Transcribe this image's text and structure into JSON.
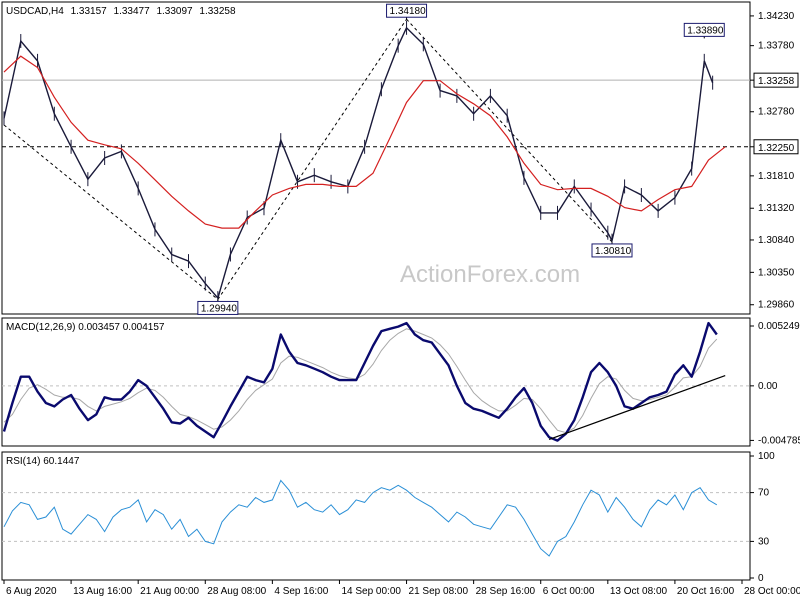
{
  "header": {
    "symbol": "USDCAD,H4",
    "open": "1.33157",
    "high": "1.33477",
    "low": "1.33097",
    "close": "1.33258"
  },
  "watermark": "ActionForex.com",
  "colors": {
    "bars": "#1a1a3a",
    "sma": "#d42020",
    "macd": "#0a0a6e",
    "signal": "#a8a8a8",
    "rsi": "#2a8fd6",
    "trend": "#000000",
    "price_tag_bg": "#ffffff"
  },
  "chart_data": [
    {
      "type": "line",
      "panel": "price",
      "ylim": [
        1.2975,
        1.3438
      ],
      "y_ticks": [
        "1.34230",
        "1.33780",
        "1.33258",
        "1.32780",
        "1.32250",
        "1.31810",
        "1.31320",
        "1.30840",
        "1.30350",
        "1.29860"
      ],
      "y_tick_values": [
        1.3423,
        1.3378,
        1.33258,
        1.3278,
        1.3225,
        1.3181,
        1.3132,
        1.3084,
        1.3035,
        1.2986
      ],
      "current_price": "1.33258",
      "current_price_value": 1.33258,
      "level_line": "1.32250",
      "level_line_value": 1.3225,
      "annotations": [
        {
          "label": "1.29940",
          "x": 25.5,
          "y": 1.2994
        },
        {
          "label": "1.34180",
          "x": 48.0,
          "y": 1.3418
        },
        {
          "label": "1.30810",
          "x": 72.5,
          "y": 1.3081
        },
        {
          "label": "1.33890",
          "x": 83.5,
          "y": 1.3389
        }
      ],
      "trendlines": [
        {
          "x": [
            0.0,
            25.5
          ],
          "y": [
            1.3258,
            1.2994
          ]
        },
        {
          "x": [
            25.5,
            48.0
          ],
          "y": [
            1.2994,
            1.3418
          ]
        },
        {
          "x": [
            48.0,
            72.5
          ],
          "y": [
            1.3418,
            1.3081
          ]
        }
      ],
      "series": [
        {
          "kind": "bars",
          "x": [
            0.0,
            2.0,
            4.0,
            6.0,
            8.0,
            10.0,
            12.0,
            14.0,
            16.0,
            18.0,
            20.0,
            22.0,
            24.0,
            25.5,
            27.0,
            29.0,
            31.0,
            33.0,
            35.0,
            37.0,
            39.0,
            41.0,
            43.0,
            45.0,
            47.0,
            48.0,
            50.0,
            52.0,
            54.0,
            56.0,
            58.0,
            60.0,
            62.0,
            64.0,
            66.0,
            68.0,
            70.0,
            72.0,
            72.5,
            74.0,
            76.0,
            78.0,
            80.0,
            82.0,
            83.5,
            84.5
          ],
          "y": [
            1.3268,
            1.3385,
            1.3355,
            1.3275,
            1.3225,
            1.3176,
            1.3208,
            1.3218,
            1.3162,
            1.31,
            1.3062,
            1.3052,
            1.3018,
            1.2996,
            1.3062,
            1.3118,
            1.3132,
            1.3235,
            1.3172,
            1.3182,
            1.3172,
            1.3165,
            1.3225,
            1.3312,
            1.3378,
            1.3405,
            1.338,
            1.331,
            1.3302,
            1.3275,
            1.3302,
            1.3272,
            1.3178,
            1.3125,
            1.3125,
            1.3165,
            1.313,
            1.3095,
            1.3083,
            1.3165,
            1.3152,
            1.3128,
            1.3148,
            1.3192,
            1.3355,
            1.3322
          ]
        },
        {
          "name": "SMA",
          "x": [
            0.0,
            2.0,
            4.0,
            6.0,
            8.0,
            10.0,
            12.0,
            14.0,
            16.0,
            18.0,
            20.0,
            22.0,
            24.0,
            26.0,
            28.0,
            30.0,
            32.0,
            34.0,
            36.0,
            38.0,
            40.0,
            42.0,
            44.0,
            46.0,
            48.0,
            50.0,
            52.0,
            54.0,
            56.0,
            58.0,
            60.0,
            62.0,
            64.0,
            66.0,
            68.0,
            70.0,
            72.0,
            74.0,
            76.0,
            78.0,
            80.0,
            82.0,
            84.0,
            86.0
          ],
          "y": [
            1.3338,
            1.3362,
            1.3345,
            1.33,
            1.3262,
            1.3235,
            1.3228,
            1.3222,
            1.32,
            1.3175,
            1.315,
            1.3128,
            1.3108,
            1.3102,
            1.3102,
            1.3128,
            1.3152,
            1.3162,
            1.3168,
            1.3168,
            1.3165,
            1.3165,
            1.3185,
            1.3238,
            1.3292,
            1.3325,
            1.3325,
            1.3305,
            1.329,
            1.3272,
            1.324,
            1.32,
            1.3168,
            1.316,
            1.3162,
            1.3162,
            1.315,
            1.3133,
            1.3128,
            1.3145,
            1.316,
            1.3165,
            1.3205,
            1.3225
          ]
        }
      ]
    },
    {
      "type": "line",
      "panel": "macd",
      "title": "MACD(12,26,9) 0.003457 0.004157",
      "ylim": [
        -0.0051,
        0.0056
      ],
      "y_ticks": [
        "0.005249",
        "0.00",
        "-0.004785"
      ],
      "y_tick_values": [
        0.005249,
        0.0,
        -0.004785
      ],
      "trendlines": [
        {
          "x": [
            65.0,
            86.0
          ],
          "y": [
            -0.0047,
            0.0009
          ]
        }
      ],
      "series": [
        {
          "name": "MACD",
          "x": [
            0.0,
            1.0,
            2.0,
            3.0,
            4.0,
            5.0,
            6.0,
            7.0,
            8.0,
            9.0,
            10.0,
            11.0,
            12.0,
            13.0,
            14.0,
            15.0,
            16.0,
            17.0,
            18.0,
            19.0,
            20.0,
            21.0,
            22.0,
            23.0,
            24.0,
            25.0,
            26.0,
            27.0,
            28.0,
            29.0,
            30.0,
            31.0,
            32.0,
            33.0,
            34.0,
            35.0,
            36.0,
            37.0,
            38.0,
            39.0,
            40.0,
            41.0,
            42.0,
            43.0,
            44.0,
            45.0,
            46.0,
            47.0,
            48.0,
            49.0,
            50.0,
            51.0,
            52.0,
            53.0,
            54.0,
            55.0,
            56.0,
            57.0,
            58.0,
            59.0,
            60.0,
            61.0,
            62.0,
            63.0,
            64.0,
            65.0,
            66.0,
            67.0,
            68.0,
            69.0,
            70.0,
            71.0,
            72.0,
            73.0,
            74.0,
            75.0,
            76.0,
            77.0,
            78.0,
            79.0,
            80.0,
            81.0,
            82.0,
            83.0,
            84.0,
            85.0
          ],
          "y": [
            -0.004,
            -0.0015,
            0.0008,
            0.0008,
            -0.0005,
            -0.0015,
            -0.0018,
            -0.0012,
            -0.0008,
            -0.002,
            -0.003,
            -0.0025,
            -0.001,
            -0.0012,
            -0.0012,
            -0.0005,
            0.0005,
            0.0,
            -0.001,
            -0.002,
            -0.0032,
            -0.0033,
            -0.0028,
            -0.0035,
            -0.004,
            -0.0045,
            -0.0032,
            -0.0018,
            -0.0005,
            0.0008,
            0.0005,
            0.0003,
            0.0015,
            0.0045,
            0.003,
            0.002,
            0.0018,
            0.0015,
            0.0012,
            0.0008,
            0.0005,
            0.0005,
            0.0005,
            0.002,
            0.0035,
            0.0048,
            0.005,
            0.0052,
            0.0055,
            0.0045,
            0.004,
            0.0038,
            0.0028,
            0.0018,
            0.0,
            -0.0015,
            -0.002,
            -0.0022,
            -0.0025,
            -0.0028,
            -0.002,
            -0.001,
            -0.0002,
            -0.0015,
            -0.0035,
            -0.0045,
            -0.0048,
            -0.0042,
            -0.003,
            -0.001,
            0.0012,
            0.002,
            0.0012,
            0.0,
            -0.0018,
            -0.002,
            -0.0015,
            -0.001,
            -0.0008,
            -0.0005,
            0.001,
            0.0018,
            0.0008,
            0.003,
            0.0055,
            0.0045
          ]
        },
        {
          "name": "Signal",
          "x": [
            0.0,
            1.0,
            2.0,
            3.0,
            4.0,
            5.0,
            6.0,
            7.0,
            8.0,
            9.0,
            10.0,
            11.0,
            12.0,
            13.0,
            14.0,
            15.0,
            16.0,
            17.0,
            18.0,
            19.0,
            20.0,
            21.0,
            22.0,
            23.0,
            24.0,
            25.0,
            26.0,
            27.0,
            28.0,
            29.0,
            30.0,
            31.0,
            32.0,
            33.0,
            34.0,
            35.0,
            36.0,
            37.0,
            38.0,
            39.0,
            40.0,
            41.0,
            42.0,
            43.0,
            44.0,
            45.0,
            46.0,
            47.0,
            48.0,
            49.0,
            50.0,
            51.0,
            52.0,
            53.0,
            54.0,
            55.0,
            56.0,
            57.0,
            58.0,
            59.0,
            60.0,
            61.0,
            62.0,
            63.0,
            64.0,
            65.0,
            66.0,
            67.0,
            68.0,
            69.0,
            70.0,
            71.0,
            72.0,
            73.0,
            74.0,
            75.0,
            76.0,
            77.0,
            78.0,
            79.0,
            80.0,
            81.0,
            82.0,
            83.0,
            84.0,
            85.0
          ],
          "y": [
            -0.0032,
            -0.0025,
            -0.0012,
            -0.0002,
            0.0001,
            -0.0003,
            -0.0008,
            -0.001,
            -0.001,
            -0.0012,
            -0.0018,
            -0.0022,
            -0.0018,
            -0.0016,
            -0.0014,
            -0.0011,
            -0.0006,
            -0.0002,
            -0.0004,
            -0.001,
            -0.0018,
            -0.0025,
            -0.0027,
            -0.003,
            -0.0034,
            -0.0038,
            -0.0036,
            -0.003,
            -0.0022,
            -0.0012,
            -0.0004,
            0.0001,
            0.0006,
            0.002,
            0.0026,
            0.0025,
            0.0022,
            0.0019,
            0.0016,
            0.0012,
            0.0009,
            0.0007,
            0.0006,
            0.001,
            0.0019,
            0.0031,
            0.004,
            0.0046,
            0.005,
            0.0048,
            0.0045,
            0.0042,
            0.0036,
            0.0028,
            0.0017,
            0.0005,
            -0.0006,
            -0.0013,
            -0.0018,
            -0.0022,
            -0.0022,
            -0.0017,
            -0.0011,
            -0.0012,
            -0.002,
            -0.003,
            -0.0039,
            -0.0041,
            -0.0037,
            -0.0026,
            -0.0011,
            0.0002,
            0.0008,
            0.0006,
            -0.0004,
            -0.0011,
            -0.0013,
            -0.0012,
            -0.001,
            -0.0008,
            -0.0001,
            0.0007,
            0.0008,
            0.0017,
            0.0033,
            0.0041
          ]
        }
      ]
    },
    {
      "type": "line",
      "panel": "rsi",
      "title": "RSI(14) 60.1447",
      "ylim": [
        0,
        100
      ],
      "y_ticks": [
        "100",
        "70",
        "30",
        "0"
      ],
      "y_tick_values": [
        100,
        70,
        30,
        0
      ],
      "levels": [
        70,
        30
      ],
      "series": [
        {
          "name": "RSI",
          "x": [
            0.0,
            1.0,
            2.0,
            3.0,
            4.0,
            5.0,
            6.0,
            7.0,
            8.0,
            9.0,
            10.0,
            11.0,
            12.0,
            13.0,
            14.0,
            15.0,
            16.0,
            17.0,
            18.0,
            19.0,
            20.0,
            21.0,
            22.0,
            23.0,
            24.0,
            25.0,
            26.0,
            27.0,
            28.0,
            29.0,
            30.0,
            31.0,
            32.0,
            33.0,
            34.0,
            35.0,
            36.0,
            37.0,
            38.0,
            39.0,
            40.0,
            41.0,
            42.0,
            43.0,
            44.0,
            45.0,
            46.0,
            47.0,
            48.0,
            49.0,
            50.0,
            51.0,
            52.0,
            53.0,
            54.0,
            55.0,
            56.0,
            57.0,
            58.0,
            59.0,
            60.0,
            61.0,
            62.0,
            63.0,
            64.0,
            65.0,
            66.0,
            67.0,
            68.0,
            69.0,
            70.0,
            71.0,
            72.0,
            73.0,
            74.0,
            75.0,
            76.0,
            77.0,
            78.0,
            79.0,
            80.0,
            81.0,
            82.0,
            83.0,
            84.0,
            85.0
          ],
          "y": [
            42,
            55,
            62,
            60,
            48,
            50,
            58,
            40,
            36,
            44,
            52,
            48,
            38,
            50,
            56,
            58,
            64,
            46,
            56,
            52,
            40,
            48,
            34,
            40,
            30,
            28,
            46,
            54,
            60,
            58,
            66,
            62,
            64,
            80,
            72,
            58,
            62,
            56,
            54,
            60,
            52,
            56,
            64,
            62,
            70,
            74,
            72,
            76,
            72,
            66,
            62,
            58,
            52,
            46,
            54,
            50,
            44,
            42,
            40,
            50,
            60,
            58,
            48,
            36,
            24,
            18,
            30,
            34,
            46,
            60,
            72,
            68,
            54,
            66,
            58,
            48,
            42,
            56,
            64,
            60,
            68,
            56,
            70,
            74,
            64,
            60
          ]
        }
      ]
    }
  ],
  "x_axis": {
    "labels": [
      "6 Aug 2020",
      "13 Aug 16:00",
      "21 Aug 00:00",
      "28 Aug 08:00",
      "4 Sep 16:00",
      "14 Sep 00:00",
      "21 Sep 08:00",
      "28 Sep 16:00",
      "6 Oct 00:00",
      "13 Oct 08:00",
      "20 Oct 16:00",
      "28 Oct 00:00"
    ],
    "label_positions": [
      0,
      8,
      16,
      24,
      32,
      40,
      48,
      56,
      64,
      72,
      80,
      88
    ],
    "range": [
      0,
      88
    ]
  }
}
